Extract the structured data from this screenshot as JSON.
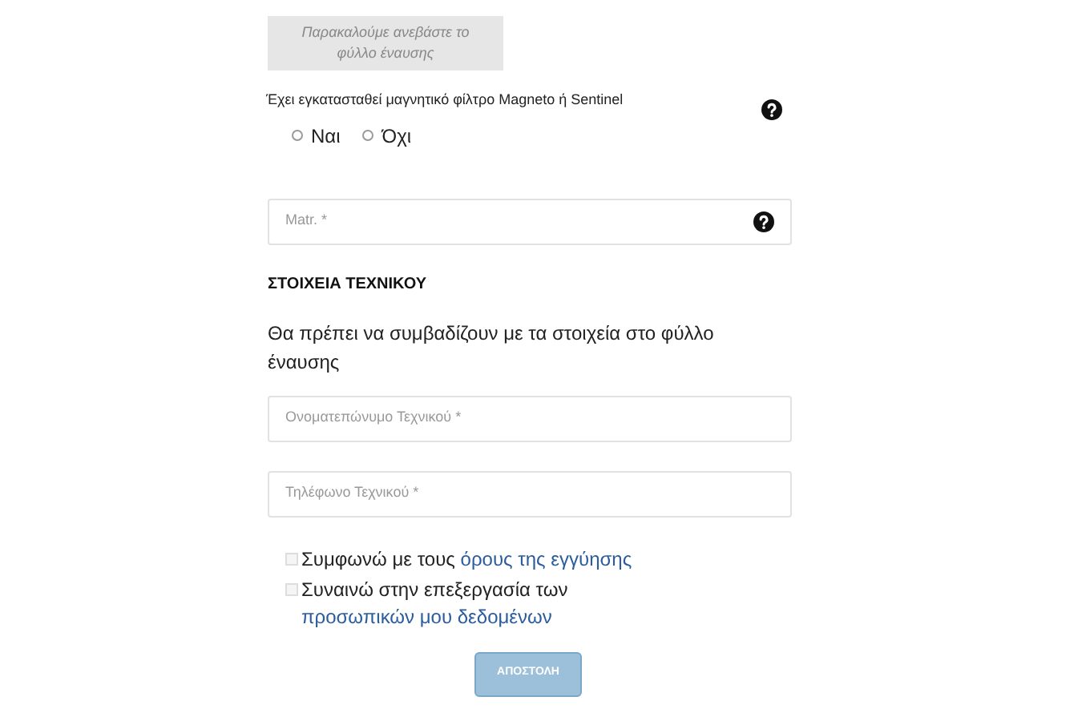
{
  "upload": {
    "text": "Παρακαλούμε ανεβάστε το φύλλο έναυσης"
  },
  "filter_question": {
    "label": "Έχει εγκατασταθεί μαγνητικό φίλτρο Magneto ή Sentinel",
    "help": true,
    "options": [
      {
        "label": "Ναι",
        "selected": false
      },
      {
        "label": "Όχι",
        "selected": false
      }
    ]
  },
  "matr_field": {
    "placeholder": "Matr. *",
    "help": true
  },
  "technician": {
    "heading": "ΣΤΟΙΧΕΙΑ ΤΕΧΝΙΚΟΥ",
    "note": "Θα πρέπει να συμβαδίζουν με τα στοιχεία στο φύλλο έναυσης",
    "fields": [
      {
        "placeholder": "Ονοματεπώνυμο Τεχνικού *"
      },
      {
        "placeholder": "Τηλέφωνο Τεχνικού *"
      }
    ]
  },
  "consents": [
    {
      "text": "Συμφωνώ με τους",
      "link": "όρους της εγγύησης",
      "checked": false
    },
    {
      "text": "Συναινώ στην επεξεργασία των",
      "link": "προσωπικών μου δεδομένων",
      "checked": false
    }
  ],
  "submit": {
    "label": "ΑΠΟΣΤΟΛΗ",
    "disabled": true
  }
}
